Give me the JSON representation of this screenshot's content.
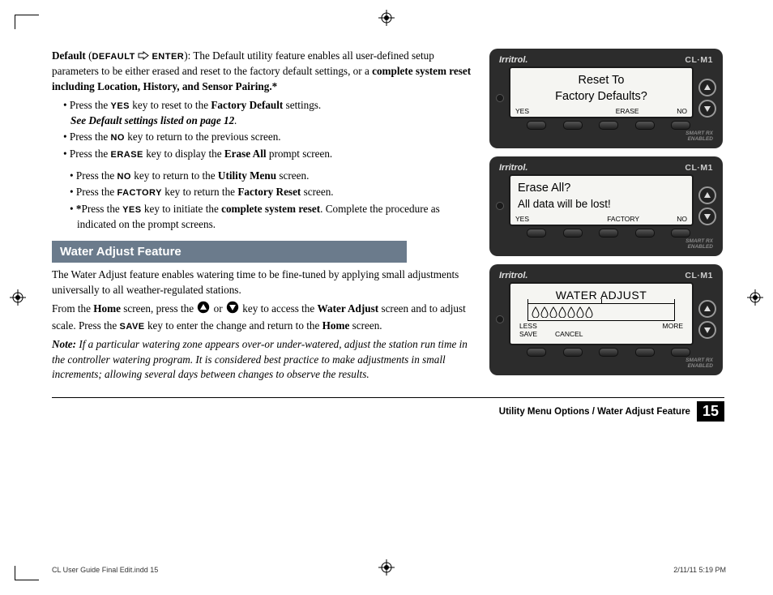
{
  "default_section": {
    "title_strong": "Default",
    "title_paren_pre": " (",
    "title_sc1": "DEFAULT",
    "title_sc2": "ENTER",
    "title_paren_post": "): ",
    "intro1": "The Default utility feature enables all user-defined setup parameters to be either erased and reset to the factory default settings, or a ",
    "intro_bold": "complete system reset including Location, History, and Sensor Pairing.*",
    "b1_pre": "Press the ",
    "b1_key": "YES",
    "b1_mid": " key to reset to the ",
    "b1_bold": "Factory Default",
    "b1_post": " settings.",
    "b1_ital": "See Default settings listed on page 12",
    "b1_ital_dot": ".",
    "b2_pre": "Press the ",
    "b2_key": "NO",
    "b2_post": " key to return to the previous screen.",
    "b3_pre": "Press the ",
    "b3_key": "ERASE",
    "b3_mid": " key to display the ",
    "b3_bold": "Erase All",
    "b3_post": " prompt screen.",
    "s1_pre": " Press the ",
    "s1_key": "NO",
    "s1_mid": " key to return to the ",
    "s1_bold": "Utility Menu",
    "s1_post": " screen.",
    "s2_pre": "Press the ",
    "s2_key": "FACTORY",
    "s2_mid": " key to return the ",
    "s2_bold": "Factory Reset",
    "s2_post": " screen.",
    "s3_star": "*",
    "s3_pre": "Press the ",
    "s3_key": "YES",
    "s3_mid": " key to initiate the ",
    "s3_bold": "complete system reset",
    "s3_post": ". Complete the procedure as indicated on the prompt screens."
  },
  "wa_section": {
    "header": "Water Adjust Feature",
    "p1": "The Water Adjust feature enables watering time to be fine-tuned by applying small adjustments universally to all weather-regulated stations.",
    "p2_pre": "From the ",
    "p2_home": "Home",
    "p2_mid1": " screen, press the ",
    "p2_or": " or ",
    "p2_mid2": " key to access the ",
    "p2_wa": "Water Adjust",
    "p2_mid3": " screen and to adjust scale. Press the ",
    "p2_save": "SAVE",
    "p2_mid4": " key to enter the change and return to the ",
    "p2_home2": "Home",
    "p2_post": " screen.",
    "note_label": "Note:",
    "note_body": " If a particular watering zone appears over-or under-watered, adjust the station run time in the controller watering program. It is considered best practice to make adjustments in small increments; allowing several days between changes to observe the results."
  },
  "devices": {
    "brand": "Irritrol",
    "brand_dot": ".",
    "model": "CL·M1",
    "smart_rx_1": "SMART RX",
    "smart_rx_2": "ENABLED",
    "d1_line1": "Reset To",
    "d1_line2": "Factory Defaults?",
    "d1_sk_yes": "YES",
    "d1_sk_erase": "ERASE",
    "d1_sk_no": "NO",
    "d2_line1": "Erase All?",
    "d2_line2": "All data will be lost!",
    "d2_sk_yes": "YES",
    "d2_sk_factory": "FACTORY",
    "d2_sk_no": "NO",
    "d3_title": "WATER ADJUST",
    "d3_less": "LESS",
    "d3_more": "MORE",
    "d3_save": "SAVE",
    "d3_cancel": "CANCEL"
  },
  "footer": {
    "text": "Utility Menu Options / Water Adjust Feature",
    "page": "15"
  },
  "indd": {
    "left": "CL User Guide Final Edit.indd   15",
    "right": "2/11/11   5:19 PM"
  }
}
